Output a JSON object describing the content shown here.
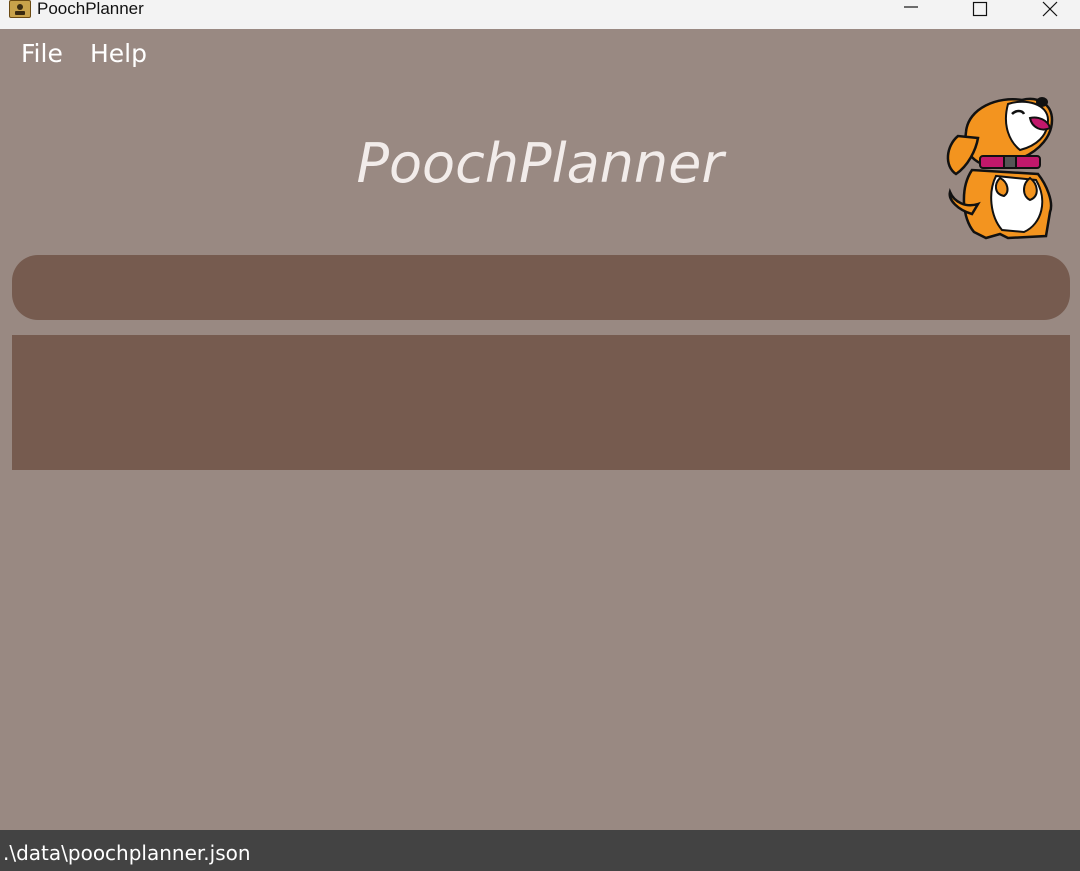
{
  "window": {
    "title": "PoochPlanner",
    "icon": "app-icon",
    "controls": [
      "minimize-icon",
      "maximize-icon",
      "close-icon"
    ]
  },
  "menu": {
    "file_label": "File",
    "help_label": "Help"
  },
  "header": {
    "title": "PoochPlanner",
    "mascot": "dog-mascot-icon"
  },
  "command_box": {
    "value": "",
    "placeholder": ""
  },
  "result_display": {
    "text": ""
  },
  "status_bar": {
    "path": ".\\data\\poochplanner.json"
  },
  "colors": {
    "background": "#998982",
    "panel": "#765b4f",
    "status_bar": "#434343",
    "title_bar": "#f3f3f3"
  }
}
